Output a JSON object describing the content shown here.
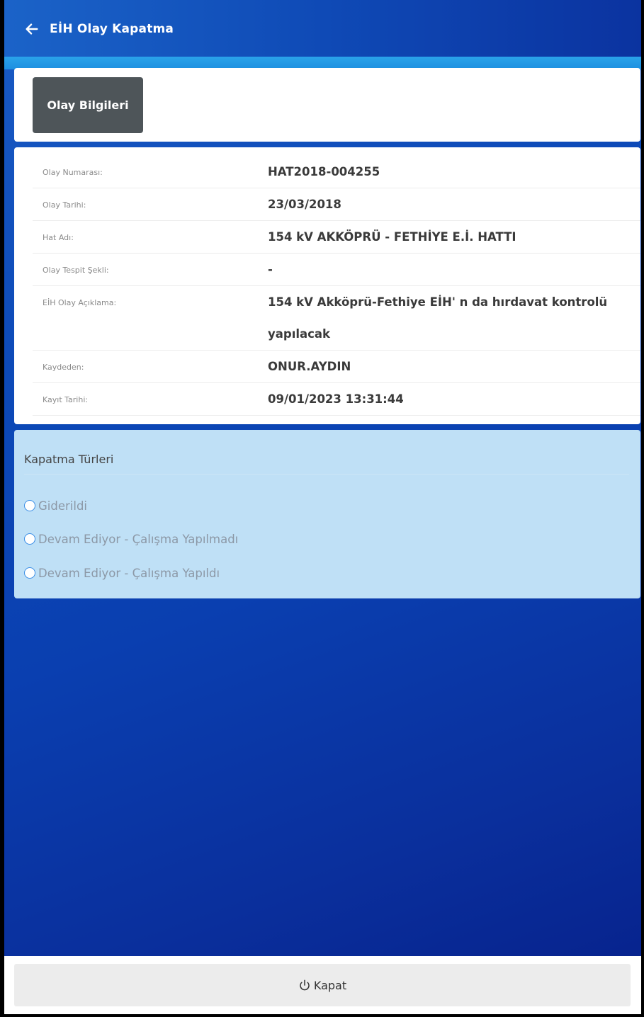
{
  "header": {
    "title": "EİH Olay Kapatma"
  },
  "tab": {
    "label": "Olay Bilgileri"
  },
  "info": {
    "rows": [
      {
        "label": "Olay Numarası:",
        "value": "HAT2018-004255"
      },
      {
        "label": "Olay Tarihi:",
        "value": "23/03/2018"
      },
      {
        "label": "Hat Adı:",
        "value": "154 kV AKKÖPRÜ - FETHİYE E.İ. HATTI"
      },
      {
        "label": "Olay Tespit Şekli:",
        "value": "-"
      },
      {
        "label": "EİH Olay Açıklama:",
        "value_line1": "154 kV Akköprü-Fethiye EİH' n da hırdavat kontrolü",
        "value_line2": "yapılacak"
      },
      {
        "label": "Kaydeden:",
        "value": "ONUR.AYDIN"
      },
      {
        "label": "Kayıt Tarihi:",
        "value": "09/01/2023 13:31:44"
      }
    ]
  },
  "closing": {
    "title": "Kapatma Türleri",
    "options": [
      {
        "label": "Giderildi"
      },
      {
        "label": "Devam Ediyor - Çalışma Yapılmadı"
      },
      {
        "label": "Devam Ediyor - Çalışma Yapıldı"
      }
    ]
  },
  "footer": {
    "button_label": "Kapat"
  }
}
